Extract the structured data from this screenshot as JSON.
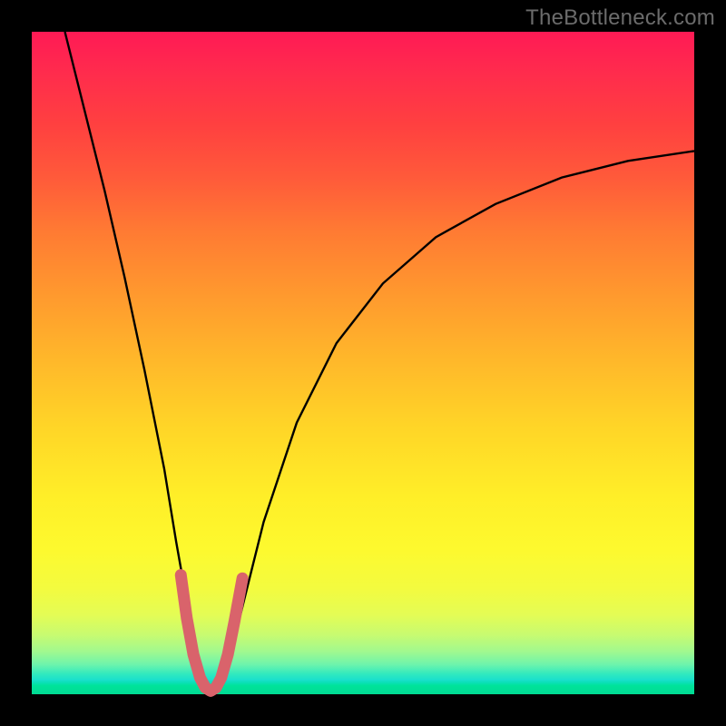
{
  "watermark": "TheBottleneck.com",
  "chart_data": {
    "type": "line",
    "title": "",
    "xlabel": "",
    "ylabel": "",
    "xlim": [
      0,
      1
    ],
    "ylim": [
      0,
      1
    ],
    "grid": false,
    "legend": false,
    "series": [
      {
        "name": "bottleneck-curve",
        "stroke": "#000000",
        "stroke_width": 2.4,
        "x": [
          0.05,
          0.08,
          0.11,
          0.14,
          0.17,
          0.2,
          0.218,
          0.234,
          0.25,
          0.262,
          0.274,
          0.286,
          0.3,
          0.32,
          0.35,
          0.4,
          0.46,
          0.53,
          0.61,
          0.7,
          0.8,
          0.9,
          1.0
        ],
        "values": [
          1.0,
          0.88,
          0.76,
          0.63,
          0.49,
          0.34,
          0.23,
          0.14,
          0.06,
          0.02,
          0.005,
          0.02,
          0.06,
          0.14,
          0.26,
          0.41,
          0.53,
          0.62,
          0.69,
          0.74,
          0.78,
          0.805,
          0.82
        ]
      },
      {
        "name": "minimum-highlight",
        "stroke": "#d9636b",
        "stroke_width": 13,
        "linecap": "round",
        "linejoin": "round",
        "x": [
          0.225,
          0.234,
          0.244,
          0.254,
          0.262,
          0.27,
          0.278,
          0.286,
          0.296,
          0.306,
          0.318
        ],
        "values": [
          0.18,
          0.115,
          0.06,
          0.025,
          0.01,
          0.005,
          0.01,
          0.025,
          0.06,
          0.11,
          0.175
        ]
      }
    ],
    "background_gradient": {
      "direction": "vertical",
      "stops": [
        {
          "pos": 0.0,
          "color": "#ff1a55"
        },
        {
          "pos": 0.5,
          "color": "#ffd627"
        },
        {
          "pos": 0.85,
          "color": "#f3fb3f"
        },
        {
          "pos": 1.0,
          "color": "#00db93"
        }
      ]
    }
  }
}
